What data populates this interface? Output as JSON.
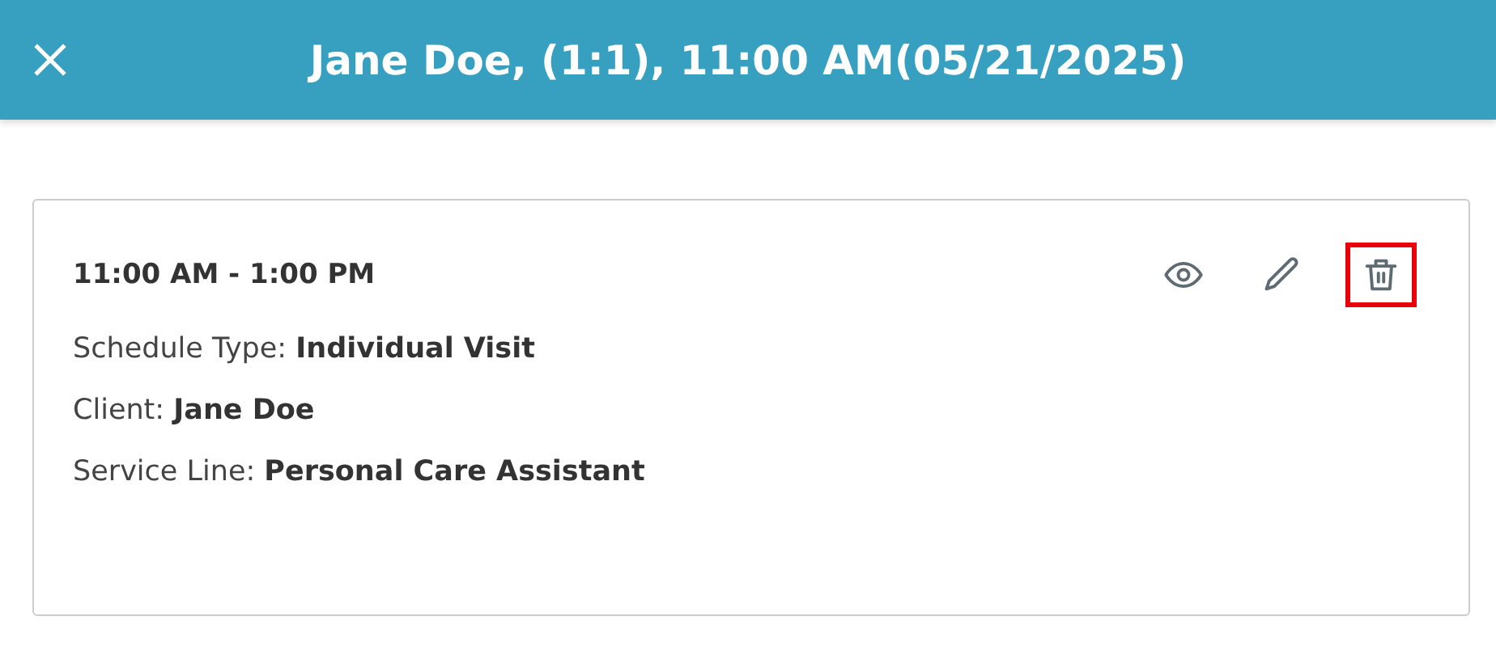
{
  "header": {
    "title": "Jane Doe, (1:1), 11:00 AM(05/21/2025)"
  },
  "card": {
    "time": "11:00 AM - 1:00 PM",
    "actions": [
      {
        "kind": "view",
        "highlighted": false
      },
      {
        "kind": "edit",
        "highlighted": false
      },
      {
        "kind": "delete",
        "highlighted": true
      }
    ],
    "fields": [
      {
        "label": "Schedule Type: ",
        "value": "Individual Visit"
      },
      {
        "label": "Client: ",
        "value": "Jane Doe"
      },
      {
        "label": "Service Line: ",
        "value": "Personal Care Assistant"
      }
    ]
  }
}
